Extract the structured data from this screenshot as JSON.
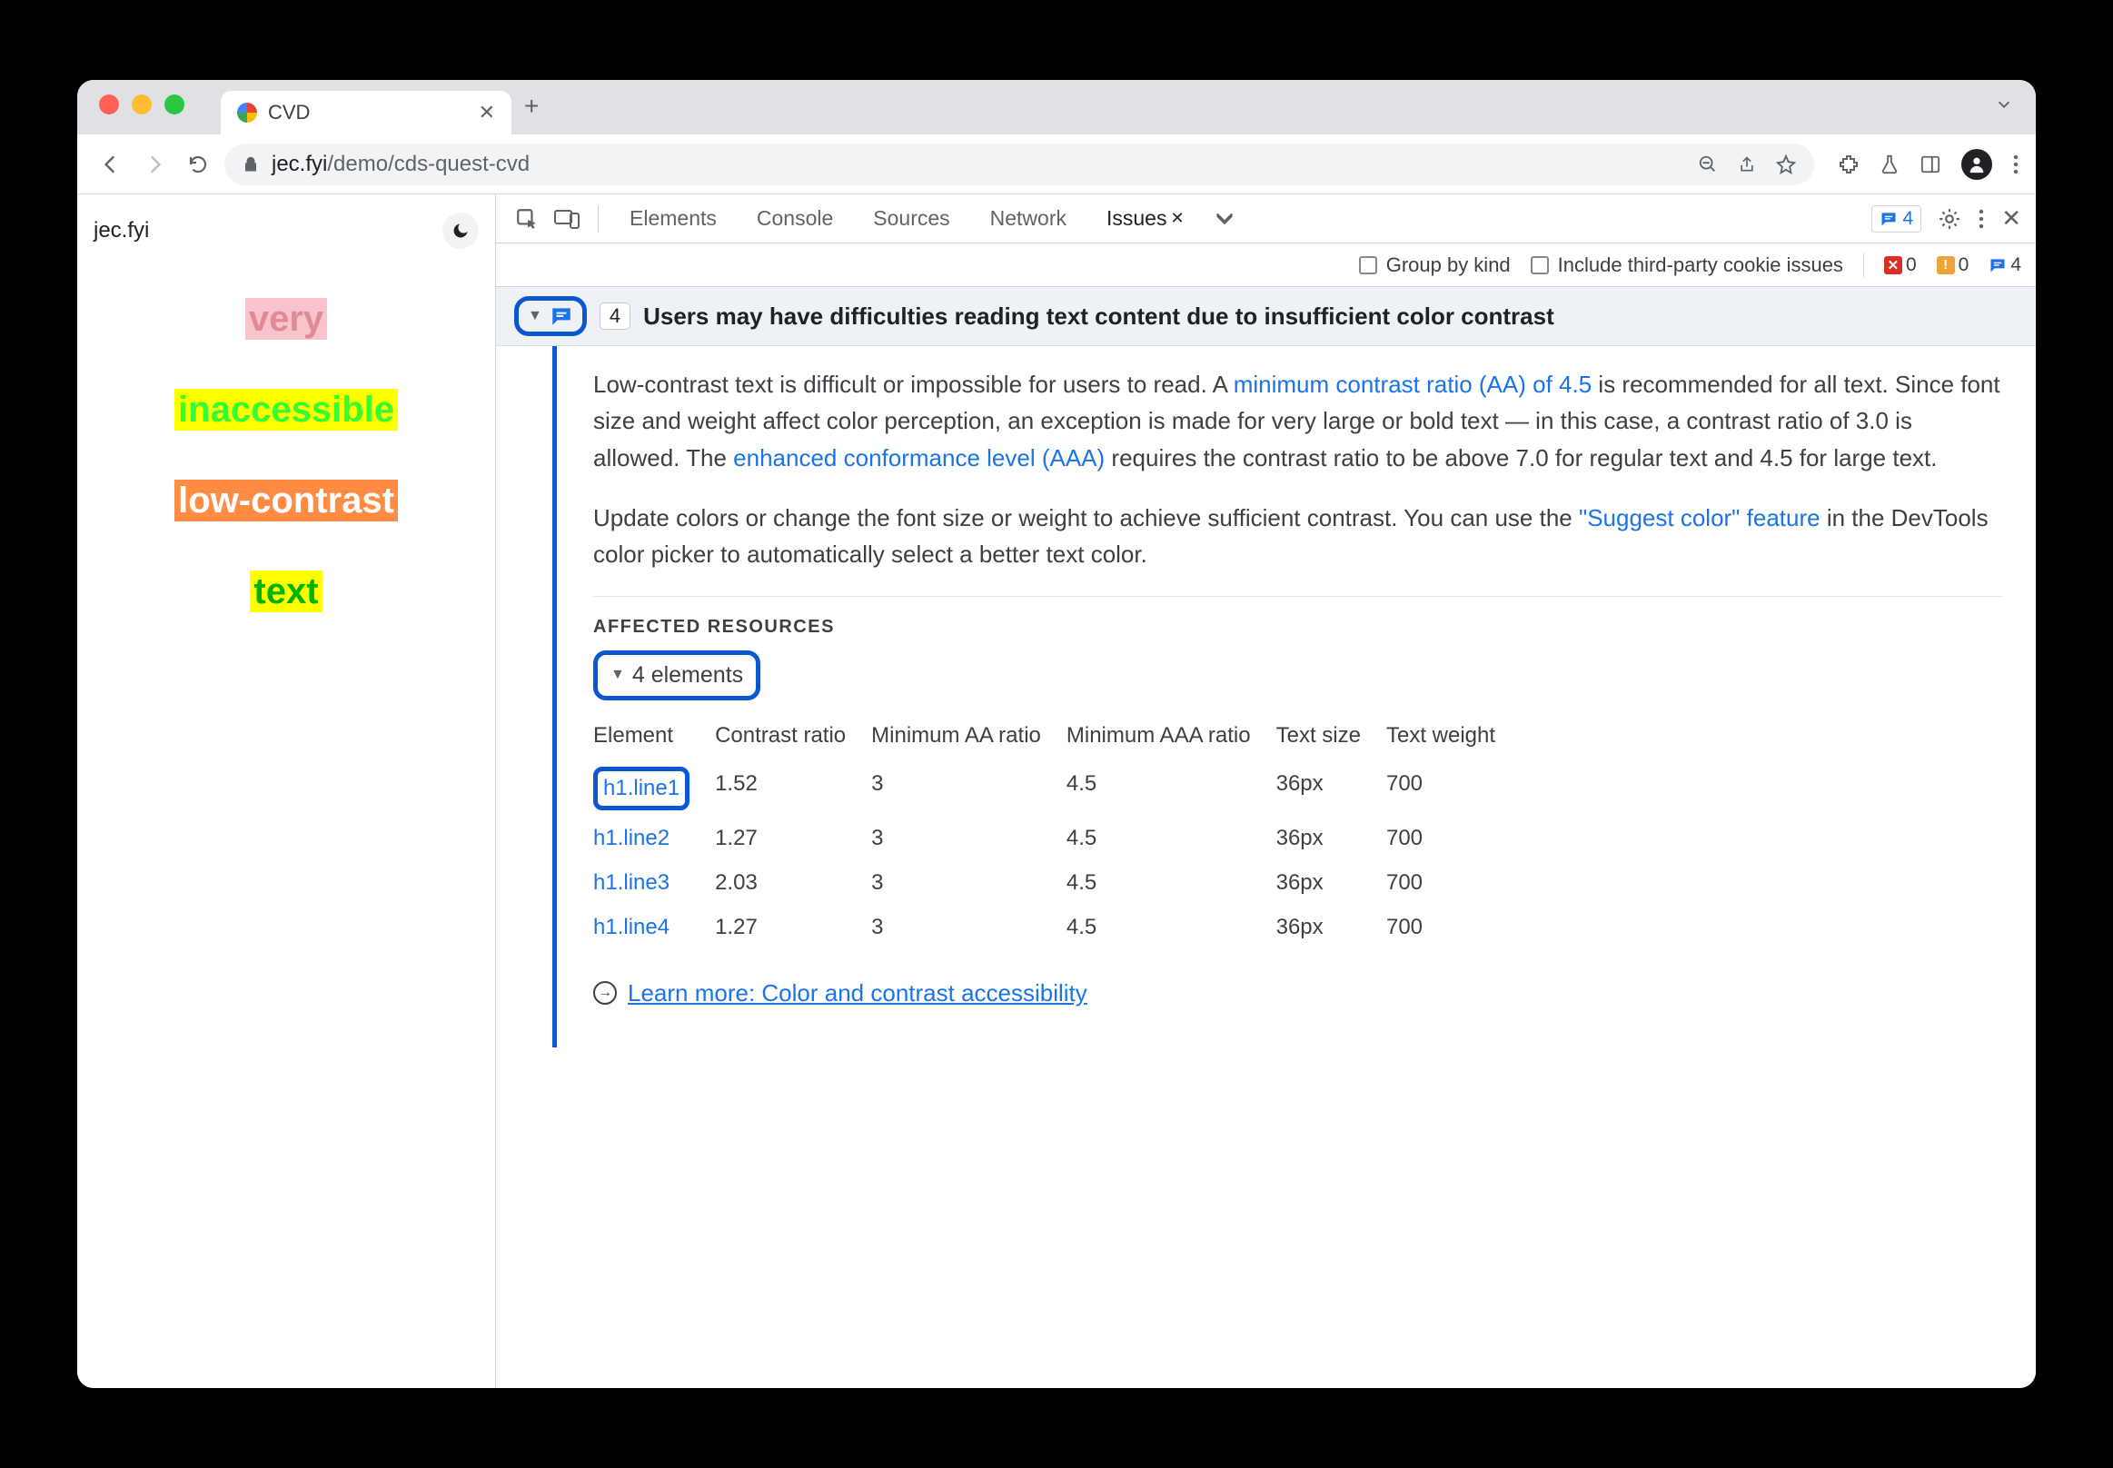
{
  "browser": {
    "tab_title": "CVD",
    "url_display": {
      "host": "jec.fyi",
      "path": "/demo/cds-quest-cvd"
    }
  },
  "page": {
    "site_label": "jec.fyi",
    "lines": [
      "very",
      "inaccessible",
      "low-contrast",
      "text"
    ]
  },
  "devtools": {
    "tabs": [
      "Elements",
      "Console",
      "Sources",
      "Network",
      "Issues"
    ],
    "active_tab": "Issues",
    "issues_badge_count": "4",
    "counts": {
      "errors": "0",
      "warnings": "0",
      "issues": "4"
    },
    "subbar": {
      "group_by_kind": "Group by kind",
      "third_party": "Include third-party cookie issues"
    },
    "issue": {
      "count": "4",
      "title": "Users may have difficulties reading text content due to insufficient color contrast",
      "para1_a": "Low-contrast text is difficult or impossible for users to read. A ",
      "link1": "minimum contrast ratio (AA) of 4.5",
      "para1_b": " is recommended for all text. Since font size and weight affect color perception, an exception is made for very large or bold text — in this case, a contrast ratio of 3.0 is allowed. The ",
      "link2": "enhanced conformance level (AAA)",
      "para1_c": " requires the contrast ratio to be above 7.0 for regular text and 4.5 for large text.",
      "para2_a": "Update colors or change the font size or weight to achieve sufficient contrast. You can use the ",
      "link3": "\"Suggest color\" feature",
      "para2_b": " in the DevTools color picker to automatically select a better text color.",
      "affected_label": "AFFECTED RESOURCES",
      "elements_label": "4 elements",
      "columns": [
        "Element",
        "Contrast ratio",
        "Minimum AA ratio",
        "Minimum AAA ratio",
        "Text size",
        "Text weight"
      ],
      "rows": [
        {
          "el": "h1.line1",
          "ratio": "1.52",
          "aa": "3",
          "aaa": "4.5",
          "size": "36px",
          "weight": "700"
        },
        {
          "el": "h1.line2",
          "ratio": "1.27",
          "aa": "3",
          "aaa": "4.5",
          "size": "36px",
          "weight": "700"
        },
        {
          "el": "h1.line3",
          "ratio": "2.03",
          "aa": "3",
          "aaa": "4.5",
          "size": "36px",
          "weight": "700"
        },
        {
          "el": "h1.line4",
          "ratio": "1.27",
          "aa": "3",
          "aaa": "4.5",
          "size": "36px",
          "weight": "700"
        }
      ],
      "learn_more": "Learn more: Color and contrast accessibility"
    }
  }
}
